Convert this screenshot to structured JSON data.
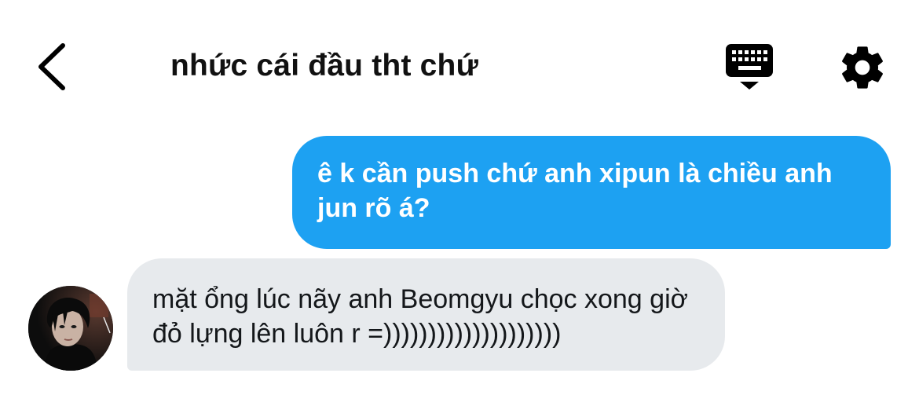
{
  "header": {
    "title": "nhức cái đầu tht chứ",
    "back_icon": "chevron-left-icon",
    "keyboard_icon": "keyboard-icon",
    "settings_icon": "gear-icon"
  },
  "messages": [
    {
      "direction": "outgoing",
      "text": "ê k cần push chứ anh xipun là chiều anh jun rõ á?"
    },
    {
      "direction": "incoming",
      "text": "mặt ổng lúc nãy anh Beomgyu chọc xong giờ đỏ lựng lên luôn r =))))))))))))))))))))"
    }
  ],
  "colors": {
    "outgoing_bubble": "#1da1f2",
    "incoming_bubble": "#e7eaed",
    "text_dark": "#14171a"
  }
}
